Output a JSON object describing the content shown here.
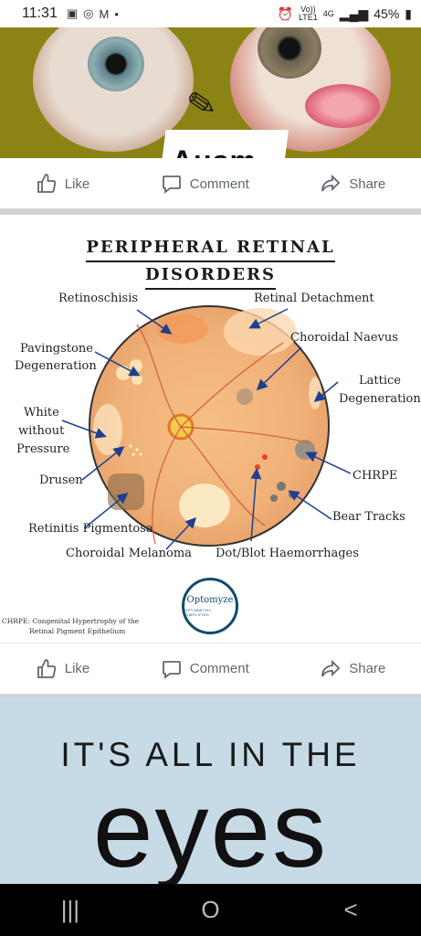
{
  "status_bar": {
    "time": "11:31",
    "icons": [
      "gallery-icon",
      "whatsapp-icon",
      "gmail-icon",
      "dot-icon"
    ],
    "network_top": "Vo))",
    "network_bottom": "LTE1",
    "network_type": "4G",
    "battery": "45%"
  },
  "post1": {
    "banner_text": "Ausm"
  },
  "actions": {
    "like": "Like",
    "comment": "Comment",
    "share": "Share"
  },
  "infographic": {
    "title_line1": "PERIPHERAL RETINAL",
    "title_line2": "DISORDERS",
    "labels": {
      "retinoschisis": "Retinoschisis",
      "retinal_detachment": "Retinal Detachment",
      "choroidal_naevus": "Choroidal Naevus",
      "pavingstone_1": "Pavingstone",
      "pavingstone_2": "Degeneration",
      "lattice_1": "Lattice",
      "lattice_2": "Degeneration",
      "white_1": "White",
      "white_2": "without",
      "white_3": "Pressure",
      "chrpe": "CHRPE",
      "drusen": "Drusen",
      "bear_tracks": "Bear Tracks",
      "retinitis": "Retinitis Pigmentosa",
      "melanoma": "Choroidal Melanoma",
      "haemorrhages": "Dot/Blot Haemorrhages"
    },
    "footnote_line1": "CHRPE: Congenital Hypertrophy of the",
    "footnote_line2": "Retinal Pigment Epithelium",
    "logo_name": "ptomyze",
    "logo_letter": "O",
    "logo_tagline": "OPTOMETRY SIMPLIFIED"
  },
  "post3": {
    "headline": "IT'S ALL IN THE",
    "big_word": "eyes"
  },
  "nav_bar": {
    "recents": "|||",
    "home": "O",
    "back": "<"
  }
}
